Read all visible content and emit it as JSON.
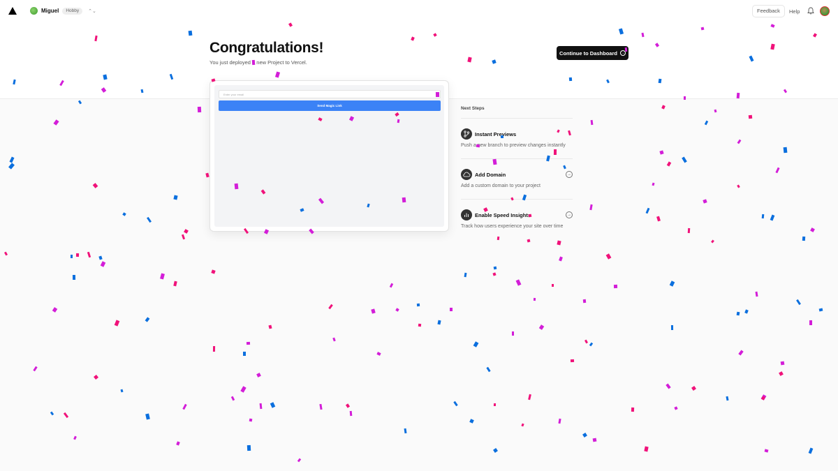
{
  "header": {
    "team_name": "Miguel",
    "plan": "Hobby",
    "feedback_label": "Feedback",
    "help_label": "Help"
  },
  "hero": {
    "title": "Congratulations!",
    "subtitle": "You just deployed a new Project to Vercel.",
    "dashboard_button": "Continue to Dashboard"
  },
  "preview": {
    "email_placeholder": "Enter your email",
    "magic_link_button": "Send Magic Link"
  },
  "next_steps": {
    "title": "Next Steps",
    "items": [
      {
        "icon": "branch-icon",
        "label": "Instant Previews",
        "description": "Push a new branch to preview changes instantly"
      },
      {
        "icon": "cloud-icon",
        "label": "Add Domain",
        "description": "Add a custom domain to your project"
      },
      {
        "icon": "chart-icon",
        "label": "Enable Speed Insights",
        "description": "Track how users experience your site over time"
      }
    ]
  },
  "colors": {
    "confetti_pink": "#f0127a",
    "confetti_magenta": "#d31ed8",
    "confetti_blue": "#0b6fde",
    "primary_button": "#111111",
    "magic_link_button": "#3b82f6"
  }
}
